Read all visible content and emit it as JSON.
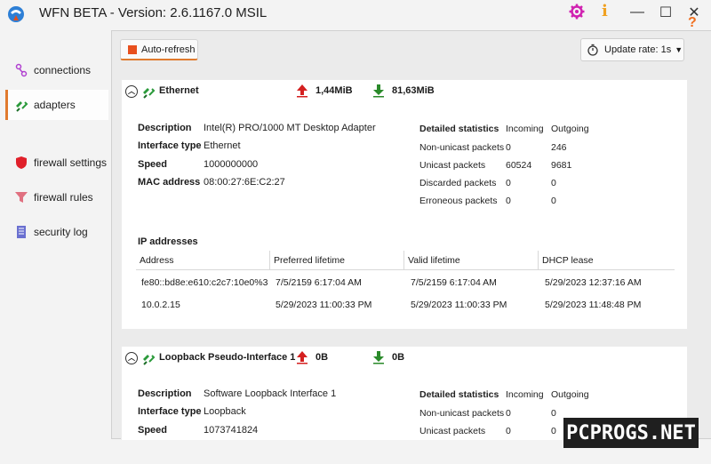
{
  "window": {
    "title": "WFN BETA - Version: 2.6.1167.0 MSIL",
    "controls": {
      "minimize": "—",
      "maximize": "☐",
      "close": "✕"
    },
    "info_glyph": "i",
    "help_glyph": "?"
  },
  "sidebar": {
    "items": [
      {
        "label": "connections",
        "icon": "connections-icon"
      },
      {
        "label": "adapters",
        "icon": "adapters-icon",
        "active": true
      },
      {
        "label": "firewall settings",
        "icon": "shield-icon"
      },
      {
        "label": "firewall rules",
        "icon": "funnel-icon"
      },
      {
        "label": "security log",
        "icon": "log-icon"
      }
    ]
  },
  "toolbar": {
    "auto_refresh_label": "Auto-refresh",
    "update_rate_label": "Update rate: 1s",
    "caret": "▼"
  },
  "adapters": [
    {
      "name": "Ethernet",
      "upload": "1,44MiB",
      "download": "81,63MiB",
      "details": {
        "description_label": "Description",
        "description": "Intel(R) PRO/1000 MT Desktop Adapter",
        "interface_type_label": "Interface type",
        "interface_type": "Ethernet",
        "speed_label": "Speed",
        "speed": "1000000000",
        "mac_label": "MAC address",
        "mac": "08:00:27:6E:C2:27"
      },
      "stats": {
        "title": "Detailed statistics",
        "incoming_label": "Incoming",
        "outgoing_label": "Outgoing",
        "rows": [
          {
            "label": "Non-unicast packets",
            "incoming": "0",
            "outgoing": "246"
          },
          {
            "label": "Unicast packets",
            "incoming": "60524",
            "outgoing": "9681"
          },
          {
            "label": "Discarded packets",
            "incoming": "0",
            "outgoing": "0"
          },
          {
            "label": "Erroneous packets",
            "incoming": "0",
            "outgoing": "0"
          }
        ]
      },
      "ip": {
        "title": "IP addresses",
        "columns": [
          "Address",
          "Preferred lifetime",
          "Valid lifetime",
          "DHCP lease"
        ],
        "rows": [
          [
            "fe80::bd8e:e610:c2c7:10e0%3",
            "7/5/2159 6:17:04 AM",
            "7/5/2159 6:17:04 AM",
            "5/29/2023 12:37:16 AM"
          ],
          [
            "10.0.2.15",
            "5/29/2023 11:00:33 PM",
            "5/29/2023 11:00:33 PM",
            "5/29/2023 11:48:48 PM"
          ]
        ]
      }
    },
    {
      "name": "Loopback Pseudo-Interface 1",
      "upload": "0B",
      "download": "0B",
      "details": {
        "description_label": "Description",
        "description": "Software Loopback Interface 1",
        "interface_type_label": "Interface type",
        "interface_type": "Loopback",
        "speed_label": "Speed",
        "speed": "1073741824"
      },
      "stats": {
        "title": "Detailed statistics",
        "incoming_label": "Incoming",
        "outgoing_label": "Outgoing",
        "rows": [
          {
            "label": "Non-unicast packets",
            "incoming": "0",
            "outgoing": "0"
          },
          {
            "label": "Unicast packets",
            "incoming": "0",
            "outgoing": "0"
          }
        ]
      }
    }
  ],
  "watermark": "PCPROGS.NET",
  "colors": {
    "accent": "#e07a2e",
    "upload": "#d42020",
    "download": "#2a8a2a",
    "help": "#f07020",
    "gear": "#d020b0"
  }
}
